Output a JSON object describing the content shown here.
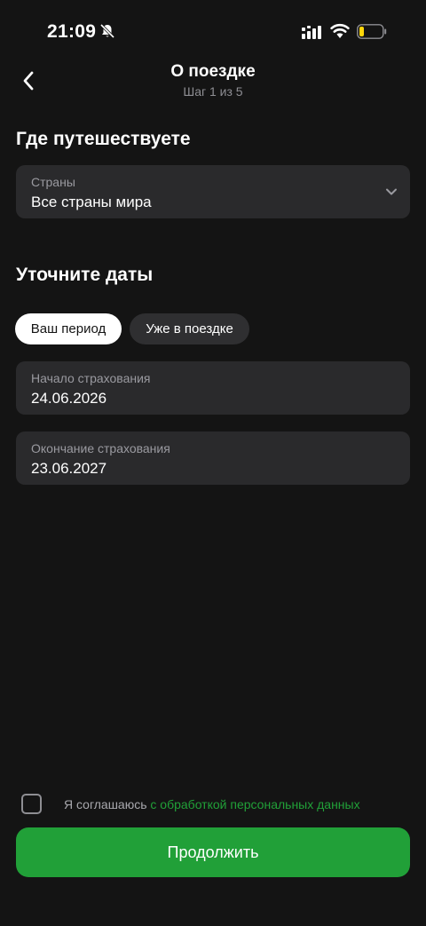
{
  "status_bar": {
    "time": "21:09",
    "icons": [
      "bell-slash-icon",
      "signal-icon",
      "wifi-icon",
      "battery-icon"
    ],
    "battery_level": 0.2
  },
  "header": {
    "title": "О поездке",
    "step": "Шаг 1 из 5",
    "back_icon": "chevron-left-icon"
  },
  "destination": {
    "section_title": "Где путешествуете",
    "countries_label": "Страны",
    "countries_value": "Все страны мира",
    "dropdown_icon": "chevron-down-icon"
  },
  "dates": {
    "section_title": "Уточните даты",
    "tabs": [
      {
        "label": "Ваш период",
        "selected": true
      },
      {
        "label": "Уже в поездке",
        "selected": false
      }
    ],
    "start_label": "Начало страхования",
    "start_value": "24.06.2026",
    "end_label": "Окончание страхования",
    "end_value": "23.06.2027"
  },
  "consent": {
    "checked": false,
    "text": "Я соглашаюсь ",
    "link_text": "с обработкой персональных данных"
  },
  "continue_label": "Продолжить",
  "colors": {
    "background": "#141414",
    "surface": "#2a2a2c",
    "accent": "#21a038",
    "text_secondary": "#9a9aa0"
  }
}
